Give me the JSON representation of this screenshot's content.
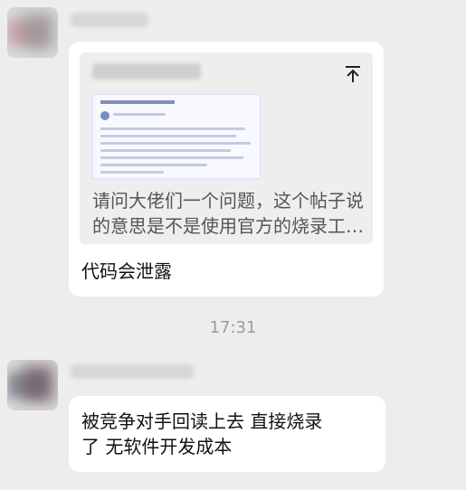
{
  "messages": [
    {
      "quote": {
        "line1": "请问大佬们一个问题，这个帖子说",
        "line2": "的意思是不是使用官方的烧录工…"
      },
      "text": "代码会泄露"
    },
    {
      "line1": "被竞争对手回读上去 直接烧录",
      "line2": "了 无软件开发成本"
    }
  ],
  "timestamp": "17:31",
  "thumb_text": {
    "title": "",
    "snippet": ""
  },
  "icons": {
    "pin": "pin-to-top-icon"
  }
}
